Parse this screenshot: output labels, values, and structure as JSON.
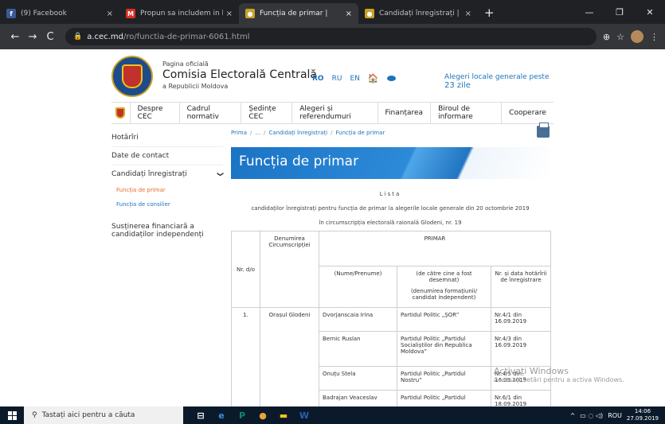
{
  "browser": {
    "tabs": [
      {
        "title": "(9) Facebook",
        "close": "×",
        "favicon": "facebook-icon",
        "color": "#3b5998",
        "glyph": "f"
      },
      {
        "title": "Propun sa includem in buletinul",
        "close": "×",
        "favicon": "gmail-icon",
        "color": "#d93025",
        "glyph": "M"
      },
      {
        "title": "Funcția de primar |",
        "close": "×",
        "favicon": "cec-icon",
        "color": "#c9a227",
        "glyph": "●"
      },
      {
        "title": "Candidați înregistrați |",
        "close": "×",
        "favicon": "cec-icon",
        "color": "#c9a227",
        "glyph": "●"
      }
    ],
    "active_tab": 2,
    "new_tab": "+",
    "window_controls": {
      "minimize": "—",
      "maximize": "❐",
      "close": "✕"
    },
    "nav": {
      "back": "←",
      "forward": "→",
      "reload": "C"
    },
    "url_host": "a.cec.md",
    "url_path": "/ro/functia-de-primar-6061.html",
    "lock": "🔒",
    "right_icons": {
      "zoom": "⊕",
      "star": "☆",
      "menu": "⋮"
    }
  },
  "site": {
    "org_small": "Pagina oficială",
    "org_name": "Comisia Electorală Centrală",
    "org_sub": "a Republicii Moldova",
    "langs": [
      "RO",
      "RU",
      "EN"
    ],
    "home": "🏠",
    "alegeri_text": "Alegeri locale generale peste",
    "alegeri_days": "23 zile",
    "menu": [
      "Despre CEC",
      "Cadrul normativ",
      "Ședințe CEC",
      "Alegeri și referendumuri",
      "Finanțarea",
      "Biroul de informare",
      "Cooperare"
    ],
    "sidebar": {
      "hotariri": "Hotărîri",
      "contact": "Date de contact",
      "candidati": "Candidați înregistrați",
      "chev": "❯",
      "sub1": "Funcția de primar",
      "sub2": "Funcția de consilier",
      "sustinere": "Susținerea financiară a candidaților independenți"
    },
    "breadcrumb": [
      "Prima",
      "...",
      "Candidați înregistrați",
      "Funcția de primar"
    ],
    "breadcrumb_sep": "/",
    "page_title": "Funcția de primar",
    "lista": "Lista",
    "description": "candidaților înregistrați pentru funcția de primar la alegerile locale generale din 20 octombrie 2019",
    "circumscriptia": "în circumscripția electorală raională Glodeni, nr. 19",
    "table": {
      "h_nr": "Nr. d/o",
      "h_den": "Denumirea Circumscripției",
      "h_primar": "PRIMAR",
      "h_nume": "(Nume/Prenume)",
      "h_desemnat": "(de către cine a fost desemnat)",
      "h_denform": "(denumirea formațiunii/ candidat independent)",
      "h_data": "Nr. și data hotărîrii de înregistrare",
      "nr": "1.",
      "circ": "Orașul Glodeni",
      "rows": [
        {
          "nume": "Dvorjanscaia Irina",
          "partid": "Partidul Politic „ȘOR”",
          "hot": "Nr.4/1 din 16.09.2019"
        },
        {
          "nume": "Bernic Ruslan",
          "partid": "Partidul Politic „Partidul Socialiștilor din Republica Moldova”",
          "hot": "Nr.4/3 din 16.09.2019"
        },
        {
          "nume": "Onuțu Stela",
          "partid": "Partidul Politic „Partidul Nostru”",
          "hot": "Nr.4/5 din 16.09.2019"
        },
        {
          "nume": "Badrajan Veaceslav",
          "partid": "Partidul Politic „Partidul",
          "hot": "Nr.6/1 din 18.09.2019"
        }
      ]
    }
  },
  "watermark": {
    "line1": "Activați Windows",
    "line2": "Accesați Setări pentru a activa Windows."
  },
  "taskbar": {
    "search_icon": "⚲",
    "search": "Tastați aici pentru a căuta",
    "apps": [
      {
        "name": "task-view-icon",
        "glyph": "⊟",
        "color": "#ffffff"
      },
      {
        "name": "edge-icon",
        "glyph": "e",
        "color": "#3b8ee8"
      },
      {
        "name": "publisher-icon",
        "glyph": "P",
        "color": "#0b8a6b"
      },
      {
        "name": "chrome-icon",
        "glyph": "●",
        "color": "#e8a33b"
      },
      {
        "name": "file-explorer-icon",
        "glyph": "▬",
        "color": "#f0c419"
      },
      {
        "name": "word-icon",
        "glyph": "W",
        "color": "#2b5fb8"
      }
    ],
    "tray_up": "^",
    "tray_icons": "▭ ◌ ◁)",
    "lang": "ROU",
    "time": "14:06",
    "date": "27.09.2019"
  }
}
